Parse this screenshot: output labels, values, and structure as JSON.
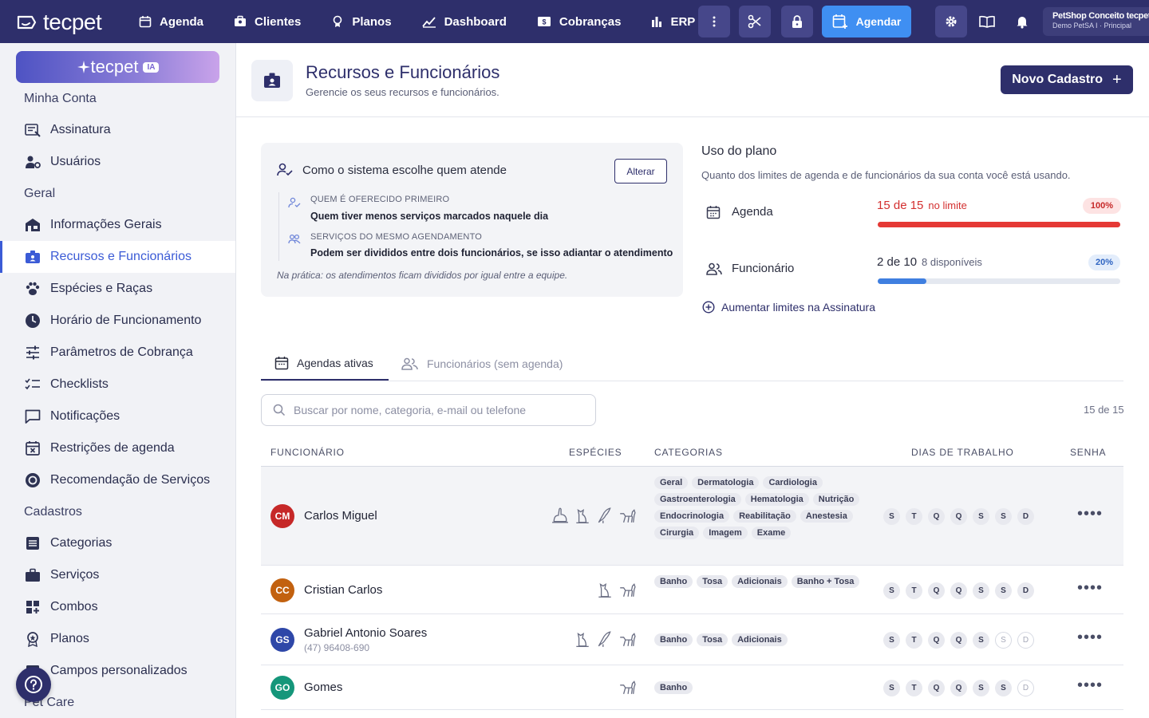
{
  "topbar": {
    "logo": "tecpet",
    "nav": [
      {
        "label": "Agenda",
        "icon": "calendar-icon"
      },
      {
        "label": "Clientes",
        "icon": "clients-icon"
      },
      {
        "label": "Planos",
        "icon": "plans-icon"
      },
      {
        "label": "Dashboard",
        "icon": "dashboard-icon"
      },
      {
        "label": "Cobranças",
        "icon": "billing-icon"
      },
      {
        "label": "ERP",
        "icon": "erp-icon"
      }
    ],
    "agendar_label": "Agendar",
    "shop_name": "PetShop Conceito tecpet",
    "shop_sub": "Demo PetSA I · Principal"
  },
  "sidebar": {
    "ia_label": "tecpet",
    "ia_badge": "IA",
    "sections": [
      {
        "title": "Minha Conta",
        "items": [
          "Assinatura",
          "Usuários"
        ]
      },
      {
        "title": "Geral",
        "items": [
          "Informações Gerais",
          "Recursos e Funcionários",
          "Espécies e Raças",
          "Horário de Funcionamento",
          "Parâmetros de Cobrança",
          "Checklists",
          "Notificações",
          "Restrições de agenda",
          "Recomendação de Serviços"
        ]
      },
      {
        "title": "Cadastros",
        "items": [
          "Categorias",
          "Serviços",
          "Combos",
          "Planos",
          "Campos personalizados"
        ]
      },
      {
        "title": "Pet Care",
        "items": []
      }
    ],
    "active_item": "Recursos e Funcionários"
  },
  "page": {
    "title": "Recursos e Funcionários",
    "subtitle": "Gerencie os seus recursos e funcionários.",
    "new_button": "Novo Cadastro",
    "new_button_plus": "+"
  },
  "how": {
    "title": "Como o sistema escolhe quem atende",
    "change_button": "Alterar",
    "rows": [
      {
        "label": "QUEM É OFERECIDO PRIMEIRO",
        "value": "Quem tiver menos serviços marcados naquele dia"
      },
      {
        "label": "SERVIÇOS DO MESMO AGENDAMENTO",
        "value": "Podem ser divididos entre dois funcionários, se isso adiantar o atendimento"
      }
    ],
    "footer": "Na prática: os atendimentos ficam divididos por igual entre a equipe."
  },
  "plan": {
    "title": "Uso do plano",
    "subtitle": "Quanto dos limites de agenda e de funcionários da sua conta você está usando.",
    "rows": [
      {
        "label": "Agenda",
        "count": "15 de 15",
        "hint": "no limite",
        "pill": "100%",
        "percent": 100,
        "color": "#e53935",
        "pill_bg": "#fde3e3",
        "pill_fg": "#c62828"
      },
      {
        "label": "Funcionário",
        "count": "2 de 10",
        "hint": "8 disponíveis",
        "pill": "20%",
        "percent": 20,
        "color": "#3f7fe0",
        "pill_bg": "#e3edfb",
        "pill_fg": "#2e64c2"
      }
    ],
    "increase_link": "Aumentar limites na Assinatura"
  },
  "tabs": [
    {
      "label": "Agendas ativas",
      "active": true
    },
    {
      "label": "Funcionários (sem agenda)",
      "active": false
    }
  ],
  "search": {
    "placeholder": "Buscar por nome, categoria, e-mail ou telefone"
  },
  "count": "15 de 15",
  "table": {
    "headers": [
      "FUNCIONÁRIO",
      "ESPÉCIES",
      "CATEGORIAS",
      "DIAS DE TRABALHO",
      "SENHA"
    ],
    "rows": [
      {
        "initials": "CM",
        "avatar_color": "#c62828",
        "name": "Carlos Miguel",
        "phone": "",
        "species": [
          "rabbit",
          "cat",
          "bird",
          "dog"
        ],
        "categories": [
          "Geral",
          "Dermatologia",
          "Cardiologia",
          "Gastroenterologia",
          "Hematologia",
          "Nutrição",
          "Endocrinologia",
          "Reabilitação",
          "Anestesia",
          "Cirurgia",
          "Imagem",
          "Exame"
        ],
        "days": [
          1,
          1,
          1,
          1,
          1,
          1,
          1
        ]
      },
      {
        "initials": "CC",
        "avatar_color": "#c2610f",
        "name": "Cristian Carlos",
        "phone": "",
        "species": [
          "cat",
          "dog"
        ],
        "categories": [
          "Banho",
          "Tosa",
          "Adicionais",
          "Banho + Tosa"
        ],
        "days": [
          1,
          1,
          1,
          1,
          1,
          1,
          1
        ]
      },
      {
        "initials": "GS",
        "avatar_color": "#2e47a8",
        "name": "Gabriel Antonio Soares",
        "phone": "(47) 96408-690",
        "species": [
          "cat",
          "bird",
          "dog"
        ],
        "categories": [
          "Banho",
          "Tosa",
          "Adicionais"
        ],
        "days": [
          1,
          1,
          1,
          1,
          1,
          0,
          0
        ]
      },
      {
        "initials": "GO",
        "avatar_color": "#15967a",
        "name": "Gomes",
        "phone": "",
        "species": [
          "dog"
        ],
        "categories": [
          "Banho"
        ],
        "days": [
          1,
          1,
          1,
          1,
          1,
          1,
          0
        ]
      }
    ],
    "day_letters": [
      "S",
      "T",
      "Q",
      "Q",
      "S",
      "S",
      "D"
    ],
    "more_label": "••••"
  }
}
